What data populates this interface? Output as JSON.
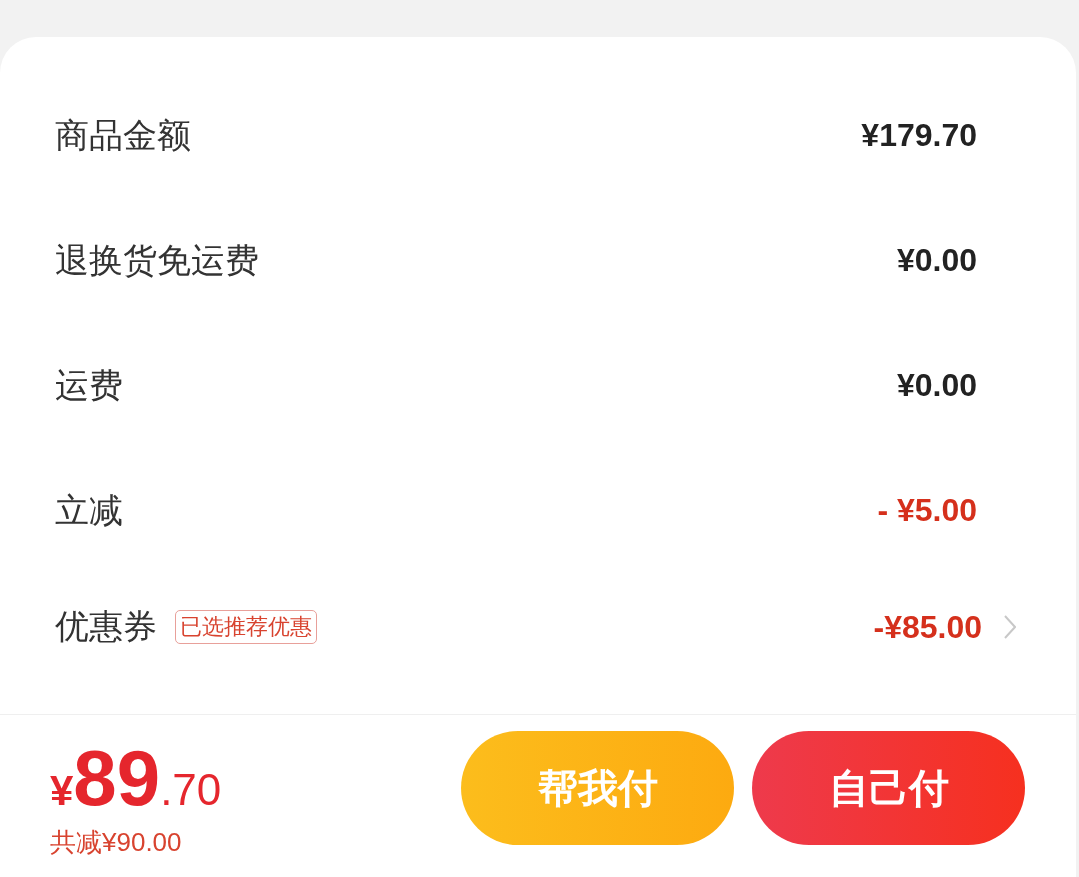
{
  "rows": [
    {
      "kind": "amount",
      "label": "商品金额",
      "value": "¥179.70"
    },
    {
      "kind": "amount",
      "label": "退换货免运费",
      "value": "¥0.00"
    },
    {
      "kind": "amount",
      "label": "运费",
      "value": "¥0.00"
    },
    {
      "kind": "discount",
      "label": "立减",
      "value": "- ¥5.00"
    },
    {
      "kind": "coupon",
      "label": "优惠券",
      "tag": "已选推荐优惠",
      "value": "-¥85.00"
    }
  ],
  "footer": {
    "total": {
      "currency": "¥",
      "integer": "89",
      "decimal": ".70"
    },
    "saved": "共减¥90.00",
    "buttons": [
      {
        "kind": "friend",
        "label": "帮我付"
      },
      {
        "kind": "self",
        "label": "自己付"
      }
    ]
  }
}
